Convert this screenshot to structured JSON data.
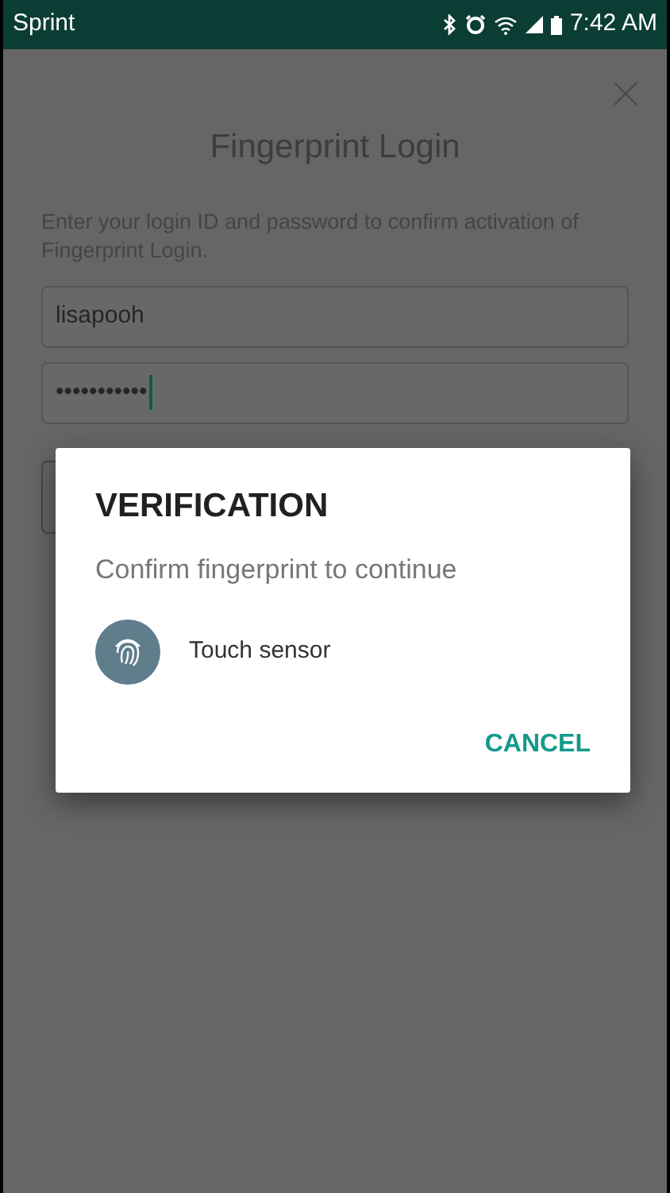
{
  "status_bar": {
    "carrier": "Sprint",
    "time": "7:42 AM"
  },
  "screen": {
    "title": "Fingerprint Login",
    "description": "Enter your login ID and password to confirm activation of Fingerprint Login.",
    "login_id": {
      "value": "lisapooh"
    },
    "password": {
      "value": "•••••••••••",
      "focused": true
    }
  },
  "dialog": {
    "title": "VERIFICATION",
    "message": "Confirm fingerprint to continue",
    "sensor_label": "Touch sensor",
    "buttons": [
      "CANCEL"
    ]
  }
}
